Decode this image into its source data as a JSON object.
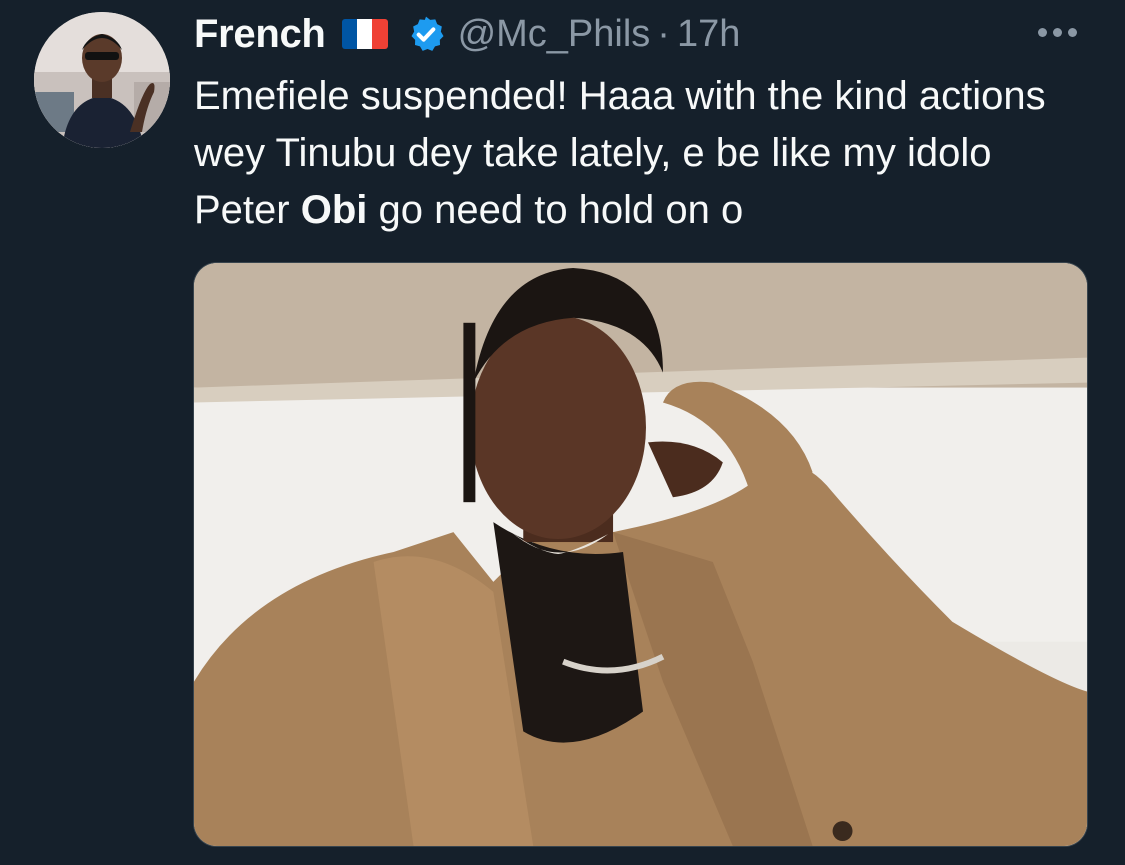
{
  "tweet": {
    "author": {
      "display_name": "French",
      "flag_icon": "france-flag-icon",
      "verified_icon": "verified-badge-icon",
      "handle": "@Mc_Phils",
      "separator": "·",
      "timestamp": "17h"
    },
    "more_icon": "more-horizontal-icon",
    "text": {
      "part1": "Emefiele suspended! Haaa with the kind actions wey Tinubu dey take lately, e be like my idolo Peter ",
      "bold": "Obi",
      "part2": " go need to hold on o"
    },
    "media": {
      "type": "photo"
    }
  },
  "colors": {
    "background": "#15202b",
    "text_primary": "#f7f9f9",
    "text_secondary": "#8b98a5",
    "verified_blue": "#1d9bf0",
    "flag_blue": "#0055a4",
    "flag_white": "#ffffff",
    "flag_red": "#ef4135"
  }
}
